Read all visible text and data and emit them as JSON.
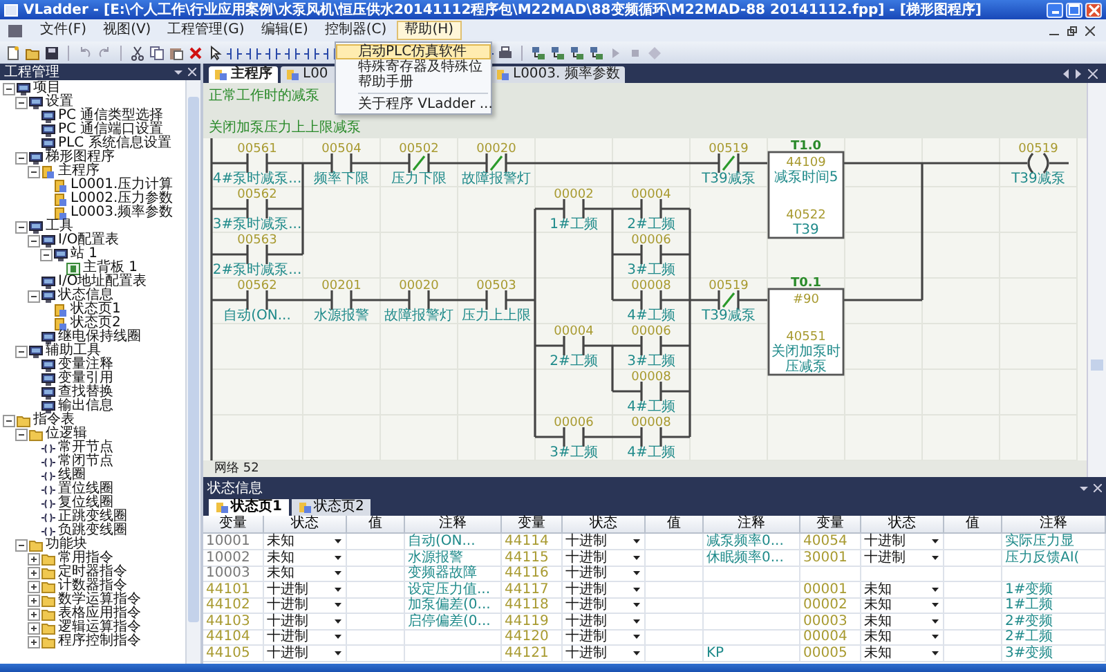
{
  "window": {
    "title": "VLadder - [E:\\个人工作\\行业应用案例\\水泵风机\\恒压供水20141112程序包\\M22MAD\\88变频循环\\M22MAD-88 20141112.fpp] - [梯形图程序]"
  },
  "menu": [
    {
      "label": "文件(F)",
      "selected": false
    },
    {
      "label": "视图(V)",
      "selected": false
    },
    {
      "label": "工程管理(G)",
      "selected": false
    },
    {
      "label": "编辑(E)",
      "selected": false
    },
    {
      "label": "控制器(C)",
      "selected": false
    },
    {
      "label": "帮助(H)",
      "selected": true
    }
  ],
  "help_menu": {
    "items": [
      {
        "label": "启动PLC仿真软件",
        "selected": true,
        "separator_before": false
      },
      {
        "label": "特殊寄存器及特殊位",
        "selected": false,
        "separator_before": false
      },
      {
        "label": "帮助手册",
        "selected": false,
        "separator_before": false
      },
      {
        "label": "关于程序 VLadder ...",
        "selected": false,
        "separator_before": true
      }
    ]
  },
  "project_panel": {
    "title": "工程管理",
    "tree": [
      {
        "label": "项目",
        "kind": "device",
        "expanded": true,
        "children": [
          {
            "label": "设置",
            "kind": "device",
            "expanded": true,
            "children": [
              {
                "label": "PC 通信类型选择",
                "kind": "device"
              },
              {
                "label": "PC 通信端口设置",
                "kind": "device"
              },
              {
                "label": "PLC 系统信息设置",
                "kind": "device"
              }
            ]
          },
          {
            "label": "梯形图程序",
            "kind": "device",
            "expanded": true,
            "children": [
              {
                "label": "主程序",
                "kind": "page",
                "expanded": true,
                "children": [
                  {
                    "label": "L0001.压力计算",
                    "kind": "page"
                  },
                  {
                    "label": "L0002.压力参数",
                    "kind": "page"
                  },
                  {
                    "label": "L0003.频率参数",
                    "kind": "page"
                  }
                ]
              }
            ]
          },
          {
            "label": "工具",
            "kind": "device",
            "expanded": true,
            "children": [
              {
                "label": "I/O配置表",
                "kind": "device",
                "expanded": true,
                "children": [
                  {
                    "label": "站 1",
                    "kind": "device",
                    "expanded": true,
                    "children": [
                      {
                        "label": "主背板 1",
                        "kind": "board"
                      }
                    ]
                  }
                ]
              },
              {
                "label": "I/O地址配置表",
                "kind": "device"
              },
              {
                "label": "状态信息",
                "kind": "device",
                "expanded": true,
                "children": [
                  {
                    "label": "状态页1",
                    "kind": "page"
                  },
                  {
                    "label": "状态页2",
                    "kind": "page"
                  }
                ]
              },
              {
                "label": "继电保持线圈",
                "kind": "device"
              }
            ]
          },
          {
            "label": "辅助工具",
            "kind": "device",
            "expanded": true,
            "children": [
              {
                "label": "变量注释",
                "kind": "device"
              },
              {
                "label": "变量引用",
                "kind": "device"
              },
              {
                "label": "查找替换",
                "kind": "device"
              },
              {
                "label": "输出信息",
                "kind": "device"
              }
            ]
          }
        ]
      },
      {
        "label": "指令表",
        "kind": "folder",
        "expanded": true,
        "children": [
          {
            "label": "位逻辑",
            "kind": "folder",
            "expanded": true,
            "children": [
              {
                "label": "常开节点",
                "kind": "instruction"
              },
              {
                "label": "常闭节点",
                "kind": "instruction"
              },
              {
                "label": "线圈",
                "kind": "instruction"
              },
              {
                "label": "置位线圈",
                "kind": "instruction"
              },
              {
                "label": "复位线圈",
                "kind": "instruction"
              },
              {
                "label": "正跳变线圈",
                "kind": "instruction"
              },
              {
                "label": "负跳变线圈",
                "kind": "instruction"
              }
            ]
          },
          {
            "label": "功能块",
            "kind": "folder",
            "expanded": true,
            "children": [
              {
                "label": "常用指令",
                "kind": "folder",
                "expanded": false
              },
              {
                "label": "定时器指令",
                "kind": "folder",
                "expanded": false
              },
              {
                "label": "计数器指令",
                "kind": "folder",
                "expanded": false
              },
              {
                "label": "数学运算指令",
                "kind": "folder",
                "expanded": false
              },
              {
                "label": "表格应用指令",
                "kind": "folder",
                "expanded": false
              },
              {
                "label": "逻辑运算指令",
                "kind": "folder",
                "expanded": false
              },
              {
                "label": "程序控制指令",
                "kind": "folder",
                "expanded": false
              }
            ]
          }
        ]
      }
    ]
  },
  "doc_tabs": [
    {
      "label": "主程序",
      "selected": true
    },
    {
      "label": "L00",
      "selected": false
    },
    {
      "label": "L0003. 频率参数",
      "selected": false
    }
  ],
  "ladder": {
    "comments": [
      "正常工作时的减泵",
      "关闭加泵压力上上限减泵"
    ],
    "elements": [
      {
        "kind": "contact_no",
        "address": "00561",
        "comment": "4#泵时减泵..."
      },
      {
        "kind": "contact_no",
        "address": "00504",
        "comment": "频率下限"
      },
      {
        "kind": "contact_nc",
        "address": "00502",
        "comment": "压力下限"
      },
      {
        "kind": "contact_nc",
        "address": "00020",
        "comment": "故障报警灯"
      },
      {
        "kind": "contact_nc",
        "address": "00519",
        "comment": "T39减泵"
      },
      {
        "kind": "block",
        "title": "T1.0",
        "upper": [
          {
            "text": "44109",
            "kind": "address"
          },
          {
            "text": "减泵时间5",
            "kind": "comment"
          }
        ],
        "lower": [
          {
            "text": "40522",
            "kind": "address"
          },
          {
            "text": "T39",
            "kind": "comment"
          }
        ]
      },
      {
        "kind": "coil",
        "address": "00519",
        "comment": "T39减泵"
      },
      {
        "kind": "contact_no",
        "address": "00562",
        "comment": "3#泵时减泵..."
      },
      {
        "kind": "contact_no",
        "address": "00002",
        "comment": "1#工频"
      },
      {
        "kind": "contact_no",
        "address": "00004",
        "comment": "2#工频"
      },
      {
        "kind": "contact_no",
        "address": "00563",
        "comment": "2#泵时减泵..."
      },
      {
        "kind": "contact_no",
        "address": "00006",
        "comment": "3#工频"
      },
      {
        "kind": "contact_no",
        "address": "00562",
        "comment": "自动(ON..."
      },
      {
        "kind": "contact_no",
        "address": "00201",
        "comment": "水源报警"
      },
      {
        "kind": "contact_no",
        "address": "00020",
        "comment": "故障报警灯"
      },
      {
        "kind": "contact_no",
        "address": "00503",
        "comment": "压力上上限"
      },
      {
        "kind": "contact_no",
        "address": "00008",
        "comment": "4#工频"
      },
      {
        "kind": "contact_nc",
        "address": "00519",
        "comment": "T39减泵"
      },
      {
        "kind": "contact_no",
        "address": "00004",
        "comment": "2#工频"
      },
      {
        "kind": "contact_no",
        "address": "00006",
        "comment": "3#工频"
      },
      {
        "kind": "block",
        "title": "T0.1",
        "upper": [
          {
            "text": "#90",
            "kind": "address"
          }
        ],
        "lower": [
          {
            "text": "40551",
            "kind": "address"
          },
          {
            "text": "关闭加泵时",
            "kind": "comment"
          },
          {
            "text": "压减泵",
            "kind": "comment"
          }
        ]
      },
      {
        "kind": "contact_no",
        "address": "00008",
        "comment": "4#工频"
      },
      {
        "kind": "contact_no",
        "address": "00006",
        "comment": "3#工频"
      },
      {
        "kind": "contact_no",
        "address": "00008",
        "comment": "4#工频"
      }
    ],
    "network": "网络 52"
  },
  "status_panel": {
    "title": "状态信息",
    "tabs": [
      {
        "label": "状态页1",
        "selected": true
      },
      {
        "label": "状态页2",
        "selected": false
      }
    ],
    "columns": [
      "变量",
      "状态",
      "值",
      "注释",
      "变量",
      "状态",
      "值",
      "注释",
      "变量",
      "状态",
      "值",
      "注释"
    ],
    "rows": [
      {
        "groups": [
          {
            "var": "10001",
            "state": "未知",
            "comment": "自动(ON..."
          },
          {
            "var": "44114",
            "state": "十进制",
            "comment": "减泵频率0..."
          },
          {
            "var": "40054",
            "state": "十进制",
            "comment": "实际压力显"
          }
        ]
      },
      {
        "groups": [
          {
            "var": "10002",
            "state": "未知",
            "comment": "水源报警"
          },
          {
            "var": "44115",
            "state": "十进制",
            "comment": "休眠频率0..."
          },
          {
            "var": "30001",
            "state": "十进制",
            "comment": "压力反馈AI("
          }
        ]
      },
      {
        "groups": [
          {
            "var": "10003",
            "state": "未知",
            "comment": "变频器故障"
          },
          {
            "var": "44116",
            "state": "十进制"
          }
        ]
      },
      {
        "groups": [
          {
            "var": "44101",
            "state": "十进制",
            "comment": "设定压力值..."
          },
          {
            "var": "44117",
            "state": "十进制"
          },
          {
            "var": "00001",
            "state": "未知",
            "comment": "1#变频"
          }
        ]
      },
      {
        "groups": [
          {
            "var": "44102",
            "state": "十进制",
            "comment": "加泵偏差(0..."
          },
          {
            "var": "44118",
            "state": "十进制"
          },
          {
            "var": "00002",
            "state": "未知",
            "comment": "1#工频"
          }
        ]
      },
      {
        "groups": [
          {
            "var": "44103",
            "state": "十进制",
            "comment": "启停偏差(0..."
          },
          {
            "var": "44119",
            "state": "十进制"
          },
          {
            "var": "00003",
            "state": "未知",
            "comment": "2#变频"
          }
        ]
      },
      {
        "groups": [
          {
            "var": "44104",
            "state": "十进制"
          },
          {
            "var": "44120",
            "state": "十进制"
          },
          {
            "var": "00004",
            "state": "未知",
            "comment": "2#工频"
          }
        ]
      },
      {
        "groups": [
          {
            "var": "44105",
            "state": "十进制"
          },
          {
            "var": "44121",
            "state": "十进制",
            "comment": "KP"
          },
          {
            "var": "00005",
            "state": "未知",
            "comment": "3#变频"
          }
        ]
      }
    ]
  }
}
